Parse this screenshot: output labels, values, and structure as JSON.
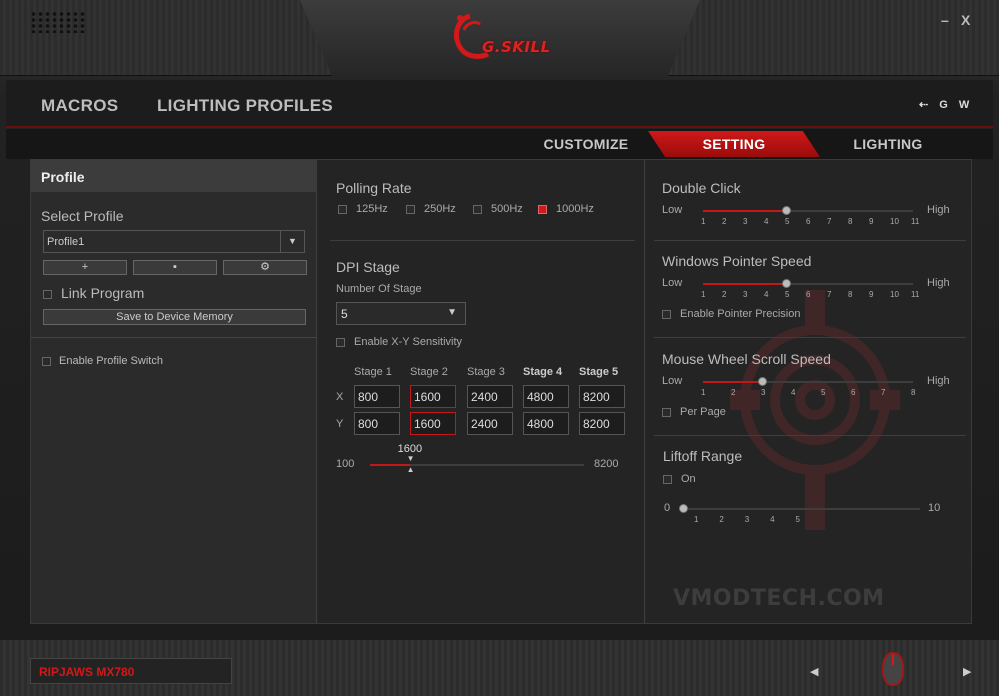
{
  "brand": {
    "logo_text": "G.SKILL",
    "accent_color": "#d21818"
  },
  "window": {
    "minimize": "–",
    "close": "X"
  },
  "main_nav": {
    "macros": "MACROS",
    "lighting_profiles": "LIGHTING PROFILES",
    "right_icons": [
      "⇠",
      "G",
      "W"
    ]
  },
  "sub_tabs": {
    "customize": "CUSTOMIZE",
    "setting": "SETTING",
    "lighting": "LIGHTING",
    "active": "SETTING"
  },
  "profile_panel": {
    "header": "Profile",
    "select_label": "Select Profile",
    "selected_profile": "Profile1",
    "buttons": {
      "add": "+",
      "delete": "▪",
      "settings": "⚙"
    },
    "link_program": "Link Program",
    "save_button": "Save to Device Memory",
    "enable_profile_switch": "Enable Profile Switch"
  },
  "polling": {
    "title": "Polling Rate",
    "options": [
      {
        "label": "125Hz",
        "checked": false
      },
      {
        "label": "250Hz",
        "checked": false
      },
      {
        "label": "500Hz",
        "checked": false
      },
      {
        "label": "1000Hz",
        "checked": true
      }
    ]
  },
  "dpi": {
    "title": "DPI Stage",
    "num_stage_label": "Number Of Stage",
    "num_stage_value": "5",
    "xy_sensitivity": "Enable X-Y Sensitivity",
    "stages": [
      "Stage 1",
      "Stage 2",
      "Stage 3",
      "Stage 4",
      "Stage 5"
    ],
    "x_label": "X",
    "y_label": "Y",
    "x_values": [
      "800",
      "1600",
      "2400",
      "4800",
      "8200"
    ],
    "y_values": [
      "800",
      "1600",
      "2400",
      "4800",
      "8200"
    ],
    "active_stage": 2,
    "slider": {
      "min": "100",
      "max": "8200",
      "value": "1600"
    }
  },
  "double_click": {
    "title": "Double Click",
    "low": "Low",
    "high": "High",
    "ticks": [
      "1",
      "2",
      "3",
      "4",
      "5",
      "6",
      "7",
      "8",
      "9",
      "10",
      "11"
    ],
    "value": 5
  },
  "pointer_speed": {
    "title": "Windows Pointer Speed",
    "low": "Low",
    "high": "High",
    "ticks": [
      "1",
      "2",
      "3",
      "4",
      "5",
      "6",
      "7",
      "8",
      "9",
      "10",
      "11"
    ],
    "value": 5,
    "precision": "Enable Pointer Precision"
  },
  "scroll_speed": {
    "title": "Mouse Wheel Scroll Speed",
    "low": "Low",
    "high": "High",
    "ticks": [
      "1",
      "2",
      "3",
      "4",
      "5",
      "6",
      "7",
      "8"
    ],
    "value": 3,
    "per_page": "Per Page"
  },
  "liftoff": {
    "title": "Liftoff Range",
    "on": "On",
    "min": "0",
    "max": "10",
    "ticks": [
      "1",
      "2",
      "3",
      "4",
      "5"
    ],
    "value": 0
  },
  "watermark": "VMODTECH.COM",
  "footer": {
    "device": "RIPJAWS MX780",
    "prev": "◀",
    "next": "▶"
  }
}
